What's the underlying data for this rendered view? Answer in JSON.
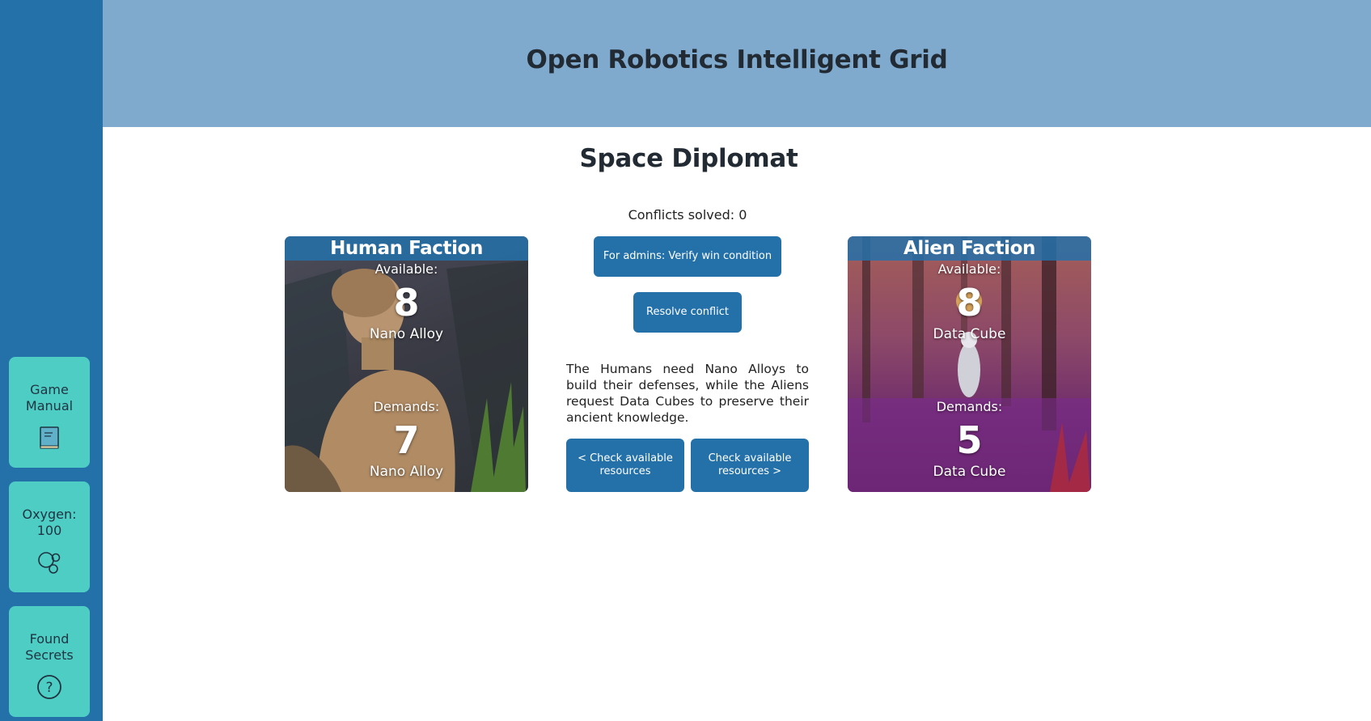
{
  "app": {
    "title": "Open Robotics Intelligent Grid"
  },
  "page": {
    "title": "Space Diplomat"
  },
  "sidebar": {
    "manual": {
      "label": "Game Manual",
      "icon": "book-icon"
    },
    "oxygen": {
      "label": "Oxygen: 100",
      "icon": "bubbles-icon"
    },
    "secrets": {
      "label": "Found Secrets",
      "icon": "question-icon"
    }
  },
  "status": {
    "conflicts": "Conflicts solved: 0"
  },
  "human": {
    "title": "Human Faction",
    "available_label": "Available:",
    "available_value": "8",
    "available_resource": "Nano Alloy",
    "demands_label": "Demands:",
    "demands_value": "7",
    "demands_resource": "Nano Alloy"
  },
  "alien": {
    "title": "Alien Faction",
    "available_label": "Available:",
    "available_value": "8",
    "available_resource": "Data Cube",
    "demands_label": "Demands:",
    "demands_value": "5",
    "demands_resource": "Data Cube"
  },
  "buttons": {
    "verify": "For admins: Verify win condition",
    "resolve": "Resolve conflict",
    "check_left": "< Check available resources",
    "check_right": "Check available resources >"
  },
  "story": "The Humans need Nano Alloys to build their defenses, while the Aliens request Data Cubes to preserve their ancient knowledge.",
  "colors": {
    "sidebar": "#2471aa",
    "tile": "#4ecdc4",
    "header": "#7faace",
    "button": "#2471aa"
  }
}
